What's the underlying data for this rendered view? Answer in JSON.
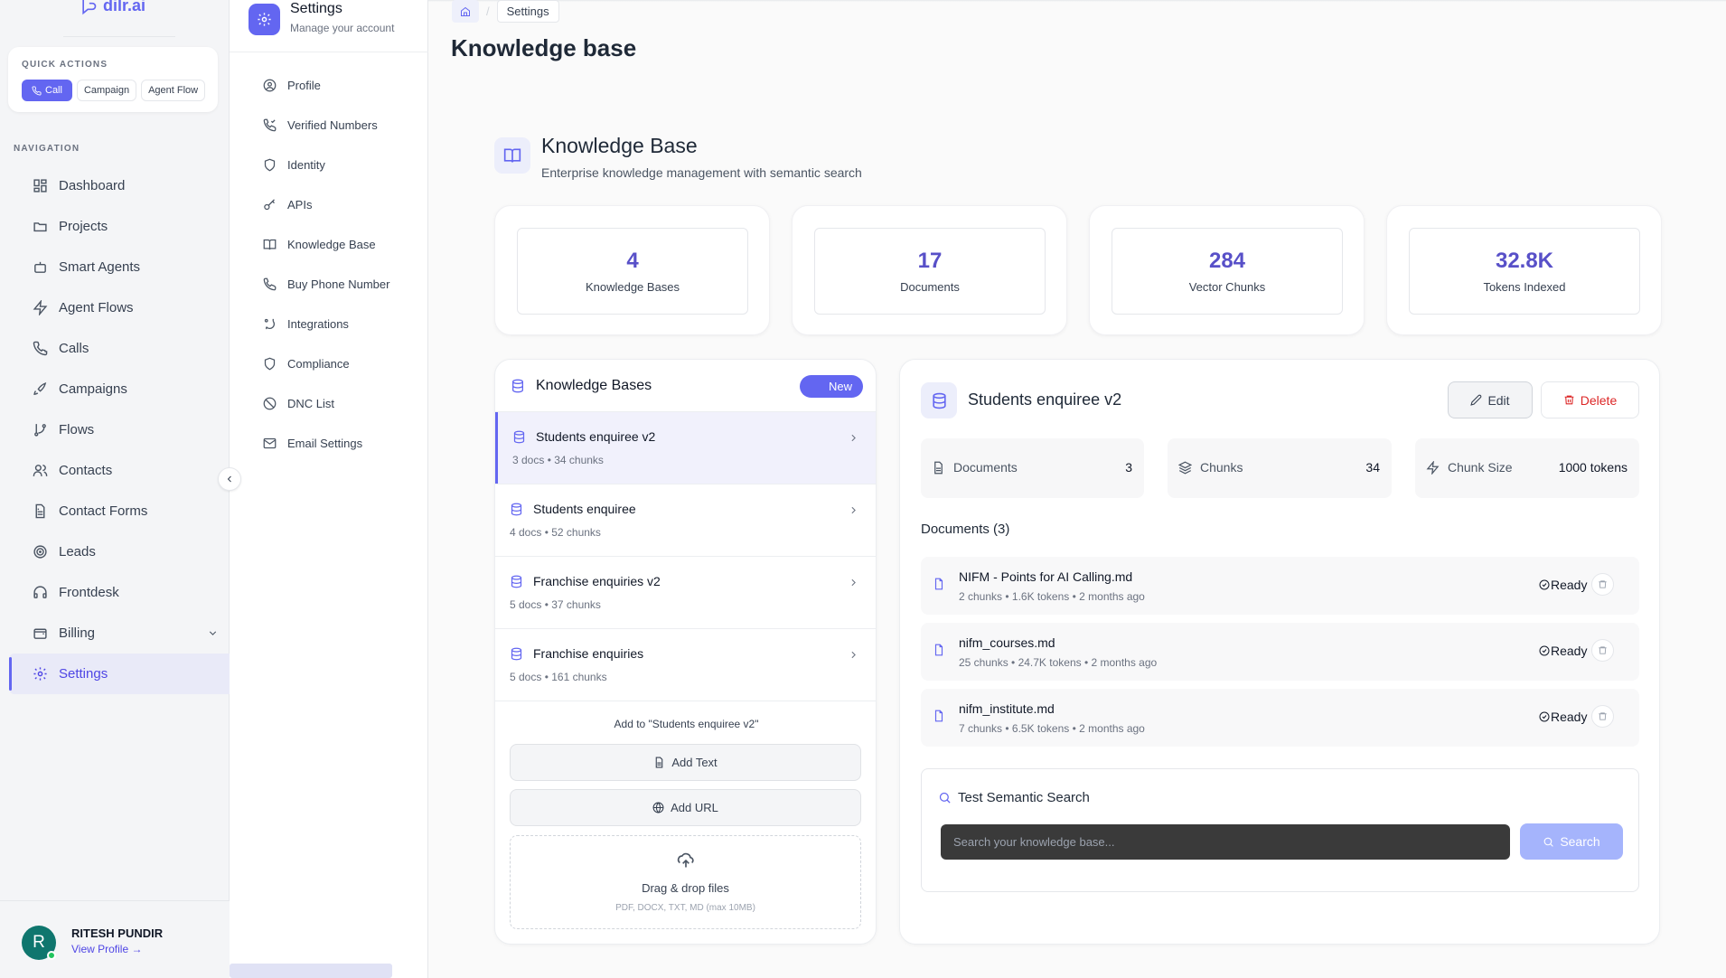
{
  "brand": {
    "name": "dilr.ai"
  },
  "quick_actions": {
    "title": "QUICK ACTIONS",
    "buttons": [
      "Call",
      "Campaign",
      "Agent Flow"
    ]
  },
  "nav": {
    "title": "NAVIGATION",
    "items": [
      {
        "label": "Dashboard",
        "icon": "dashboard-icon"
      },
      {
        "label": "Projects",
        "icon": "folder-icon"
      },
      {
        "label": "Smart Agents",
        "icon": "bot-icon"
      },
      {
        "label": "Agent Flows",
        "icon": "zap-icon"
      },
      {
        "label": "Calls",
        "icon": "phone-icon"
      },
      {
        "label": "Campaigns",
        "icon": "rocket-icon"
      },
      {
        "label": "Flows",
        "icon": "git-branch-icon"
      },
      {
        "label": "Contacts",
        "icon": "users-icon"
      },
      {
        "label": "Contact Forms",
        "icon": "file-text-icon"
      },
      {
        "label": "Leads",
        "icon": "target-icon"
      },
      {
        "label": "Frontdesk",
        "icon": "headphones-icon"
      },
      {
        "label": "Billing",
        "icon": "wallet-icon"
      },
      {
        "label": "Settings",
        "icon": "gear-icon"
      }
    ],
    "active": "Settings"
  },
  "user": {
    "initial": "R",
    "name": "RITESH PUNDIR",
    "link": "View Profile →"
  },
  "settings_menu": {
    "title": "Settings",
    "subtitle": "Manage your account",
    "items": [
      "Profile",
      "Verified Numbers",
      "Identity",
      "APIs",
      "Knowledge Base",
      "Buy Phone Number",
      "Integrations",
      "Compliance",
      "DNC List",
      "Email Settings"
    ]
  },
  "breadcrumb": {
    "current": "Settings"
  },
  "page": {
    "title": "Knowledge base",
    "section_title": "Knowledge Base",
    "section_subtitle": "Enterprise knowledge management with semantic search"
  },
  "stats": [
    {
      "value": "4",
      "label": "Knowledge Bases"
    },
    {
      "value": "17",
      "label": "Documents"
    },
    {
      "value": "284",
      "label": "Vector Chunks"
    },
    {
      "value": "32.8K",
      "label": "Tokens Indexed"
    }
  ],
  "kb_list": {
    "title": "Knowledge Bases",
    "new_label": "New",
    "items": [
      {
        "name": "Students enquiree v2",
        "meta": "3 docs • 34 chunks"
      },
      {
        "name": "Students enquiree",
        "meta": "4 docs • 52 chunks"
      },
      {
        "name": "Franchise enquiries v2",
        "meta": "5 docs • 37 chunks"
      },
      {
        "name": "Franchise enquiries",
        "meta": "5 docs • 161 chunks"
      }
    ],
    "add_to": "Add to \"Students enquiree v2\"",
    "add_text": "Add Text",
    "add_url": "Add URL",
    "drop_title": "Drag & drop files",
    "drop_formats": "PDF, DOCX, TXT, MD (max 10MB)"
  },
  "detail": {
    "title": "Students enquiree v2",
    "edit_label": "Edit",
    "delete_label": "Delete",
    "metrics": [
      {
        "label": "Documents",
        "value": "3"
      },
      {
        "label": "Chunks",
        "value": "34"
      },
      {
        "label": "Chunk Size",
        "value": "1000 tokens"
      }
    ],
    "docs_heading": "Documents (3)",
    "documents": [
      {
        "name": "NIFM - Points for AI Calling.md",
        "meta": "2 chunks • 1.6K tokens • 2 months ago",
        "status": "Ready"
      },
      {
        "name": "nifm_courses.md",
        "meta": "25 chunks • 24.7K tokens • 2 months ago",
        "status": "Ready"
      },
      {
        "name": "nifm_institute.md",
        "meta": "7 chunks • 6.5K tokens • 2 months ago",
        "status": "Ready"
      }
    ]
  },
  "semantic_search": {
    "title": "Test Semantic Search",
    "placeholder": "Search your knowledge base...",
    "button": "Search"
  },
  "colors": {
    "accent": "#6366f1",
    "danger": "#dc2626",
    "search_button": "#a5b4fc"
  }
}
